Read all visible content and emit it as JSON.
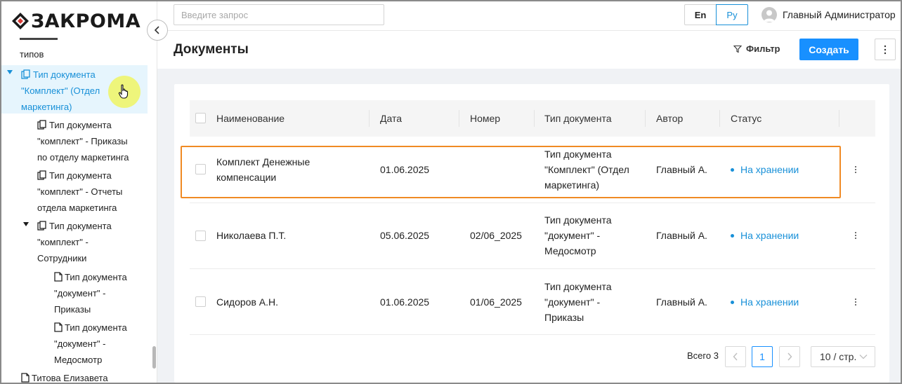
{
  "app": {
    "logo_text": "ЗАКРОМА"
  },
  "sidebar": {
    "items": [
      {
        "lines": [
          "типов"
        ],
        "icon": "none",
        "caret": false,
        "selected": false
      },
      {
        "lines": [
          "Тип документа",
          "\"Комплект\" (Отдел",
          "маркетинга)"
        ],
        "icon": "copy-icon",
        "caret": true,
        "selected": true
      },
      {
        "lines": [
          "Тип документа",
          "\"комплект\" - Приказы",
          "по отделу маркетинга"
        ],
        "icon": "copy-icon",
        "caret": false,
        "selected": false
      },
      {
        "lines": [
          "Тип документа",
          "\"комплект\" - Отчеты",
          "отдела маркетинга"
        ],
        "icon": "copy-icon",
        "caret": false,
        "selected": false
      },
      {
        "lines": [
          "Тип документа",
          "\"комплект\" -",
          "Сотрудники"
        ],
        "icon": "copy-icon",
        "caret": true,
        "selected": false
      },
      {
        "lines": [
          "Тип документа",
          "\"документ\" -",
          "Приказы"
        ],
        "icon": "file-icon",
        "caret": false,
        "selected": false
      },
      {
        "lines": [
          "Тип документа",
          "\"документ\" -",
          "Медосмотр"
        ],
        "icon": "file-icon",
        "caret": false,
        "selected": false
      },
      {
        "lines": [
          "Титова Елизавета"
        ],
        "icon": "file-icon",
        "caret": false,
        "selected": false
      }
    ]
  },
  "topbar": {
    "search_placeholder": "Введите запрос",
    "lang_en": "En",
    "lang_ru": "Ру",
    "user_name": "Главный Администратор"
  },
  "page": {
    "title": "Документы",
    "filter_label": "Фильтр",
    "create_label": "Создать"
  },
  "table": {
    "columns": [
      "Наименование",
      "Дата",
      "Номер",
      "Тип документа",
      "Автор",
      "Статус"
    ],
    "rows": [
      {
        "name": [
          "Комплект Денежные",
          "компенсации"
        ],
        "date": "01.06.2025",
        "number": "",
        "doctype": [
          "Тип документа",
          "\"Комплект\" (Отдел",
          "маркетинга)"
        ],
        "author": "Главный А.",
        "status": "На хранении"
      },
      {
        "name": [
          "Николаева П.Т."
        ],
        "date": "05.06.2025",
        "number": "02/06_2025",
        "doctype": [
          "Тип документа",
          "\"документ\" -",
          "Медосмотр"
        ],
        "author": "Главный А.",
        "status": "На хранении"
      },
      {
        "name": [
          "Сидоров А.Н."
        ],
        "date": "01.06.2025",
        "number": "01/06_2025",
        "doctype": [
          "Тип документа",
          "\"документ\" -",
          "Приказы"
        ],
        "author": "Главный А.",
        "status": "На хранении"
      }
    ]
  },
  "pagination": {
    "total_label": "Всего 3",
    "current_page": "1",
    "page_size": "10 / стр."
  },
  "colors": {
    "accent": "#1890ff",
    "selected_bg": "#e6f5fd",
    "highlight": "#f08a24",
    "logo_mark": "#d83a36"
  }
}
